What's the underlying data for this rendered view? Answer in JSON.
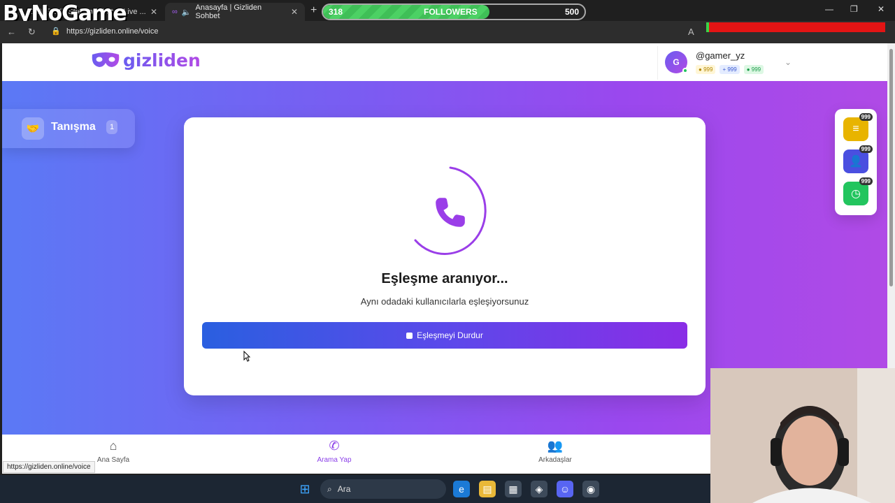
{
  "overlay": {
    "logo_text": "ByNoGame",
    "followers": {
      "current": "318",
      "label": "FOLLOWERS",
      "goal": "500",
      "progress": 0.636
    }
  },
  "browser": {
    "tabs": [
      {
        "title": "GAMERYZ Stream - Watch Live ..."
      },
      {
        "title": "Anasayfa | Gizliden Sohbet"
      }
    ],
    "url": "https://gizliden.online/voice",
    "new_tab_icon": "plus-icon"
  },
  "header": {
    "brand": "gizliden",
    "username": "@gamer_yz",
    "avatar_letter": "G",
    "stats": {
      "coins": "999",
      "friends": "999",
      "time": "999"
    }
  },
  "sidebar": {
    "item_label": "Tanışma",
    "item_count": "1"
  },
  "card": {
    "title": "Eşleşme aranıyor...",
    "subtitle": "Aynı odadaki kullanıcılarla eşleşiyorsunuz",
    "stop_button": "Eşleşmeyi Durdur"
  },
  "rewards": [
    {
      "icon": "coins-icon",
      "badge": "999",
      "color": "#e8b400"
    },
    {
      "icon": "add-user-icon",
      "badge": "999",
      "color": "#4a4fe0"
    },
    {
      "icon": "clock-icon",
      "badge": "999",
      "color": "#22c55e"
    }
  ],
  "bottom_nav": [
    {
      "label": "Ana Sayfa",
      "icon": "home-icon"
    },
    {
      "label": "Arama Yap",
      "icon": "phone-icon"
    },
    {
      "label": "Arkadaşlar",
      "icon": "users-icon"
    }
  ],
  "status_bar_url": "https://gizliden.online/voice",
  "taskbar": {
    "search_placeholder": "Ara"
  }
}
